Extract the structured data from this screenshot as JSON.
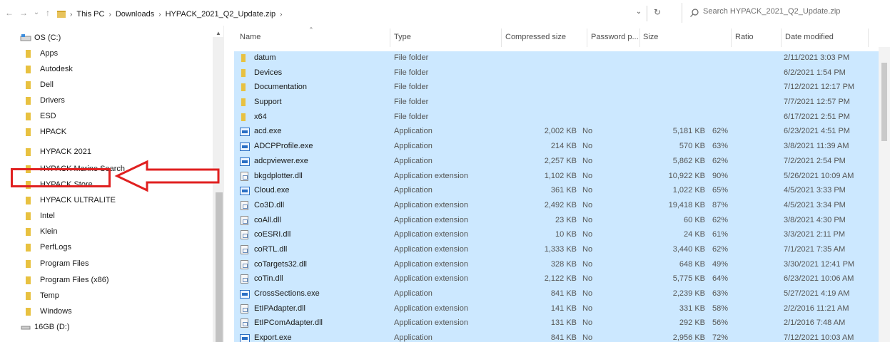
{
  "address_bar": {
    "back_glyph": "←",
    "forward_glyph": "→",
    "recent_glyph": "⌄",
    "up_glyph": "↑",
    "crumbs": [
      "This PC",
      "Downloads",
      "HYPACK_2021_Q2_Update.zip"
    ],
    "dropdown_glyph": "⌄",
    "refresh_glyph": "↻",
    "search_placeholder": "Search HYPACK_2021_Q2_Update.zip"
  },
  "nav_pane": {
    "drive_c": "OS (C:)",
    "folders": [
      "Apps",
      "Autodesk",
      "Dell",
      "Drivers",
      "ESD",
      "HPACK",
      "HYPACK 2021",
      "HYPACK Marine Search",
      "HYPACK Store",
      "HYPACK ULTRALITE",
      "Intel",
      "Klein",
      "PerfLogs",
      "Program Files",
      "Program Files (x86)",
      "Temp",
      "Windows"
    ],
    "drive_d": "16GB (D:)",
    "highlighted_folder": "HYPACK 2021",
    "annotation_color": "#e02020"
  },
  "columns": {
    "name": "Name",
    "type": "Type",
    "compressed_size": "Compressed size",
    "password": "Password p...",
    "size": "Size",
    "ratio": "Ratio",
    "date_modified": "Date modified"
  },
  "files": [
    {
      "name": "datum",
      "type": "File folder",
      "icon": "folder-icon",
      "compressed": "",
      "password": "",
      "size": "",
      "ratio": "",
      "date": "2/11/2021 3:03 PM"
    },
    {
      "name": "Devices",
      "type": "File folder",
      "icon": "folder-icon",
      "compressed": "",
      "password": "",
      "size": "",
      "ratio": "",
      "date": "6/2/2021 1:54 PM"
    },
    {
      "name": "Documentation",
      "type": "File folder",
      "icon": "folder-icon",
      "compressed": "",
      "password": "",
      "size": "",
      "ratio": "",
      "date": "7/12/2021 12:17 PM"
    },
    {
      "name": "Support",
      "type": "File folder",
      "icon": "folder-icon",
      "compressed": "",
      "password": "",
      "size": "",
      "ratio": "",
      "date": "7/7/2021 12:57 PM"
    },
    {
      "name": "x64",
      "type": "File folder",
      "icon": "folder-icon",
      "compressed": "",
      "password": "",
      "size": "",
      "ratio": "",
      "date": "6/17/2021 2:51 PM"
    },
    {
      "name": "acd.exe",
      "type": "Application",
      "icon": "application-icon",
      "compressed": "2,002 KB",
      "password": "No",
      "size": "5,181 KB",
      "ratio": "62%",
      "date": "6/23/2021 4:51 PM"
    },
    {
      "name": "ADCPProfile.exe",
      "type": "Application",
      "icon": "application-icon",
      "compressed": "214 KB",
      "password": "No",
      "size": "570 KB",
      "ratio": "63%",
      "date": "3/8/2021 11:39 AM"
    },
    {
      "name": "adcpviewer.exe",
      "type": "Application",
      "icon": "application-icon",
      "compressed": "2,257 KB",
      "password": "No",
      "size": "5,862 KB",
      "ratio": "62%",
      "date": "7/2/2021 2:54 PM"
    },
    {
      "name": "bkgdplotter.dll",
      "type": "Application extension",
      "icon": "dll-icon",
      "compressed": "1,102 KB",
      "password": "No",
      "size": "10,922 KB",
      "ratio": "90%",
      "date": "5/26/2021 10:09 AM"
    },
    {
      "name": "Cloud.exe",
      "type": "Application",
      "icon": "application-icon",
      "compressed": "361 KB",
      "password": "No",
      "size": "1,022 KB",
      "ratio": "65%",
      "date": "4/5/2021 3:33 PM"
    },
    {
      "name": "Co3D.dll",
      "type": "Application extension",
      "icon": "dll-icon",
      "compressed": "2,492 KB",
      "password": "No",
      "size": "19,418 KB",
      "ratio": "87%",
      "date": "4/5/2021 3:34 PM"
    },
    {
      "name": "coAll.dll",
      "type": "Application extension",
      "icon": "dll-icon",
      "compressed": "23 KB",
      "password": "No",
      "size": "60 KB",
      "ratio": "62%",
      "date": "3/8/2021 4:30 PM"
    },
    {
      "name": "coESRI.dll",
      "type": "Application extension",
      "icon": "dll-icon",
      "compressed": "10 KB",
      "password": "No",
      "size": "24 KB",
      "ratio": "61%",
      "date": "3/3/2021 2:11 PM"
    },
    {
      "name": "coRTL.dll",
      "type": "Application extension",
      "icon": "dll-icon",
      "compressed": "1,333 KB",
      "password": "No",
      "size": "3,440 KB",
      "ratio": "62%",
      "date": "7/1/2021 7:35 AM"
    },
    {
      "name": "coTargets32.dll",
      "type": "Application extension",
      "icon": "dll-icon",
      "compressed": "328 KB",
      "password": "No",
      "size": "648 KB",
      "ratio": "49%",
      "date": "3/30/2021 12:41 PM"
    },
    {
      "name": "coTin.dll",
      "type": "Application extension",
      "icon": "dll-icon",
      "compressed": "2,122 KB",
      "password": "No",
      "size": "5,775 KB",
      "ratio": "64%",
      "date": "6/23/2021 10:06 AM"
    },
    {
      "name": "CrossSections.exe",
      "type": "Application",
      "icon": "application-icon",
      "compressed": "841 KB",
      "password": "No",
      "size": "2,239 KB",
      "ratio": "63%",
      "date": "5/27/2021 4:19 AM"
    },
    {
      "name": "EtIPAdapter.dll",
      "type": "Application extension",
      "icon": "dll-icon",
      "compressed": "141 KB",
      "password": "No",
      "size": "331 KB",
      "ratio": "58%",
      "date": "2/2/2016 11:21 AM"
    },
    {
      "name": "EtIPComAdapter.dll",
      "type": "Application extension",
      "icon": "dll-icon",
      "compressed": "131 KB",
      "password": "No",
      "size": "292 KB",
      "ratio": "56%",
      "date": "2/1/2016 7:48 AM"
    },
    {
      "name": "Export.exe",
      "type": "Application",
      "icon": "application-icon",
      "compressed": "841 KB",
      "password": "No",
      "size": "2,956 KB",
      "ratio": "72%",
      "date": "7/12/2021 10:03 AM"
    }
  ],
  "selection_color": "#cce8ff"
}
